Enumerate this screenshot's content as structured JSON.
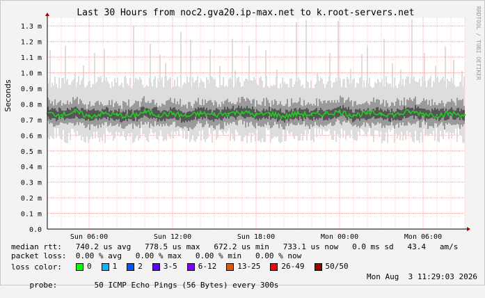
{
  "chart_data": {
    "type": "line",
    "title": "Last 30 Hours from noc2.gva20.ip-max.net to k.root-servers.net",
    "ylabel": "Seconds",
    "xlabel": "",
    "watermark": "RRDTOOL / TOBI OETIKER",
    "ylim": [
      0,
      1.35
    ],
    "y_ticks": [
      {
        "v": 0.0,
        "label": "0.0"
      },
      {
        "v": 0.1,
        "label": "0.1 m"
      },
      {
        "v": 0.2,
        "label": "0.2 m"
      },
      {
        "v": 0.3,
        "label": "0.3 m"
      },
      {
        "v": 0.4,
        "label": "0.4 m"
      },
      {
        "v": 0.5,
        "label": "0.5 m"
      },
      {
        "v": 0.6,
        "label": "0.6 m"
      },
      {
        "v": 0.7,
        "label": "0.7 m"
      },
      {
        "v": 0.8,
        "label": "0.8 m"
      },
      {
        "v": 0.9,
        "label": "0.9 m"
      },
      {
        "v": 1.0,
        "label": "1.0 m"
      },
      {
        "v": 1.1,
        "label": "1.1 m"
      },
      {
        "v": 1.2,
        "label": "1.2 m"
      },
      {
        "v": 1.3,
        "label": "1.3 m"
      }
    ],
    "x_range_hours": [
      0,
      30
    ],
    "x_ticks": [
      {
        "h": 3.0,
        "label": "Sun 06:00"
      },
      {
        "h": 9.0,
        "label": "Sun 12:00"
      },
      {
        "h": 15.0,
        "label": "Sun 18:00"
      },
      {
        "h": 21.0,
        "label": "Mon 00:00"
      },
      {
        "h": 27.0,
        "label": "Mon 06:00"
      }
    ],
    "grid": true,
    "series": [
      {
        "name": "median rtt",
        "color": "#22cc22",
        "x_hours": [
          0,
          1,
          2,
          3,
          4,
          5,
          6,
          7,
          8,
          9,
          10,
          11,
          12,
          13,
          14,
          15,
          16,
          17,
          18,
          19,
          20,
          21,
          22,
          23,
          24,
          25,
          26,
          27,
          28,
          29,
          30
        ],
        "values": [
          0.74,
          0.73,
          0.75,
          0.72,
          0.74,
          0.73,
          0.72,
          0.75,
          0.73,
          0.74,
          0.72,
          0.74,
          0.73,
          0.74,
          0.75,
          0.73,
          0.74,
          0.72,
          0.74,
          0.73,
          0.74,
          0.75,
          0.73,
          0.74,
          0.74,
          0.73,
          0.75,
          0.74,
          0.73,
          0.74,
          0.73
        ]
      }
    ],
    "smoke_color": "#555555",
    "spike_hours": [
      0.2,
      1.3,
      2.0,
      2.6,
      3.4,
      4.1,
      5.6,
      6.2,
      7.4,
      8.1,
      8.5,
      9.6,
      10.3,
      10.8,
      11.7,
      12.4,
      13.3,
      13.5,
      14.5,
      15.7,
      16.5,
      16.9,
      17.9,
      18.6,
      19.4,
      20.3,
      20.9,
      21.8,
      22.6,
      23.0,
      24.2,
      24.8,
      25.4,
      26.2,
      27.1,
      27.9,
      28.6,
      29.2,
      29.8
    ]
  },
  "stats": {
    "median_rtt_line": "median rtt:   740.2 us avg   778.5 us max   672.2 us min   733.1 us now   0.0 ms sd   43.4   am/s",
    "packet_loss_line": "packet loss:  0.00 % avg   0.00 % max   0.00 % min   0.00 % now"
  },
  "legend": {
    "title": "loss color:",
    "items": [
      {
        "label": "0",
        "color": "#00ff00"
      },
      {
        "label": "1",
        "color": "#00b8ff"
      },
      {
        "label": "2",
        "color": "#0059ff"
      },
      {
        "label": "3-5",
        "color": "#5e00ff"
      },
      {
        "label": "6-12",
        "color": "#7e00ff"
      },
      {
        "label": "13-25",
        "color": "#dd5511"
      },
      {
        "label": "26-49",
        "color": "#ff0000"
      },
      {
        "label": "50/50",
        "color": "#a00000"
      }
    ]
  },
  "probe": {
    "label": "probe:",
    "description": "50 ICMP Echo Pings (56 Bytes) every 300s",
    "timestamp": "Mon Aug  3 11:29:03 2026"
  }
}
